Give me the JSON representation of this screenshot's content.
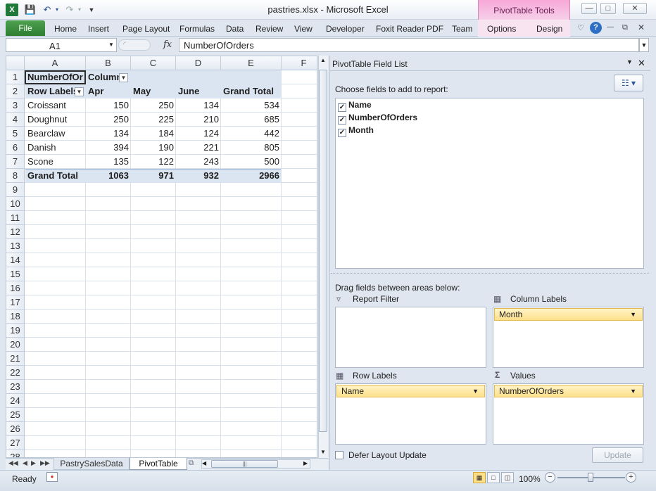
{
  "window": {
    "title": "pastries.xlsx - Microsoft Excel",
    "context_tab": "PivotTable Tools",
    "qat": {
      "save_icon": "save-icon",
      "undo_icon": "undo-icon",
      "redo_icon": "redo-icon"
    }
  },
  "ribbon": {
    "file": "File",
    "tabs": [
      "Home",
      "Insert",
      "Page Layout",
      "Formulas",
      "Data",
      "Review",
      "View",
      "Developer",
      "Foxit Reader PDF",
      "Team",
      "Options",
      "Design"
    ]
  },
  "formula_bar": {
    "name_box": "A1",
    "fx": "fx",
    "formula": "NumberOfOrders"
  },
  "grid": {
    "columns": [
      "A",
      "B",
      "C",
      "D",
      "E",
      "F"
    ],
    "rows": [
      "1",
      "2",
      "3",
      "4",
      "5",
      "6",
      "7",
      "8",
      "9",
      "10",
      "11",
      "12",
      "13",
      "14",
      "15",
      "16",
      "17",
      "18",
      "19",
      "20",
      "21",
      "22",
      "23",
      "24",
      "25",
      "26",
      "27",
      "28"
    ],
    "pivot": {
      "data_field": "NumberOfOr",
      "col_labels": "Column",
      "row_labels": "Row Labels",
      "months": [
        "Apr",
        "May",
        "June"
      ],
      "grand_total_col": "Grand Total",
      "body": [
        {
          "name": "Croissant",
          "apr": "150",
          "may": "250",
          "june": "134",
          "total": "534"
        },
        {
          "name": "Doughnut",
          "apr": "250",
          "may": "225",
          "june": "210",
          "total": "685"
        },
        {
          "name": "Bearclaw",
          "apr": "134",
          "may": "184",
          "june": "124",
          "total": "442"
        },
        {
          "name": "Danish",
          "apr": "394",
          "may": "190",
          "june": "221",
          "total": "805"
        },
        {
          "name": "Scone",
          "apr": "135",
          "may": "122",
          "june": "243",
          "total": "500"
        }
      ],
      "grand_total": {
        "label": "Grand Total",
        "apr": "1063",
        "may": "971",
        "june": "932",
        "total": "2966"
      }
    }
  },
  "sheets": {
    "tabs": [
      "PastrySalesData",
      "PivotTable"
    ],
    "active": "PivotTable"
  },
  "status": {
    "ready": "Ready",
    "zoom": "100%"
  },
  "field_list": {
    "title": "PivotTable Field List",
    "choose_label": "Choose fields to add to report:",
    "fields": [
      "Name",
      "NumberOfOrders",
      "Month"
    ],
    "drag_label": "Drag fields between areas below:",
    "report_filter": "Report Filter",
    "column_labels": "Column Labels",
    "row_labels": "Row Labels",
    "values": "Values",
    "column_item": "Month",
    "row_item": "Name",
    "value_item": "NumberOfOrders",
    "defer": "Defer Layout Update",
    "update": "Update"
  }
}
